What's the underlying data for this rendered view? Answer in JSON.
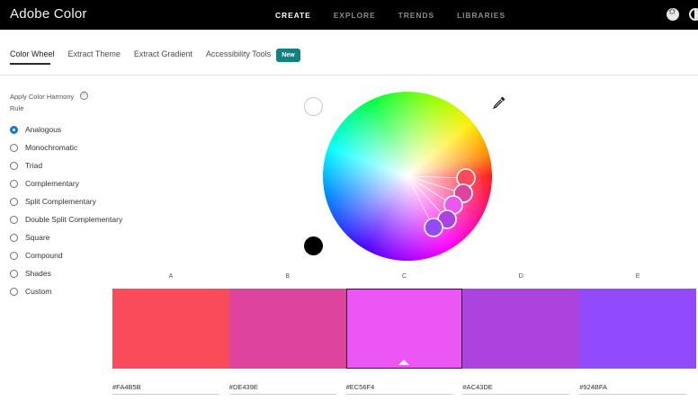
{
  "app": {
    "title": "Adobe Color"
  },
  "topnav": [
    {
      "label": "CREATE",
      "active": true
    },
    {
      "label": "EXPLORE",
      "active": false
    },
    {
      "label": "TRENDS",
      "active": false
    },
    {
      "label": "LIBRARIES",
      "active": false
    }
  ],
  "tabs": [
    {
      "label": "Color Wheel",
      "active": true
    },
    {
      "label": "Extract Theme"
    },
    {
      "label": "Extract Gradient"
    },
    {
      "label": "Accessibility Tools"
    }
  ],
  "badge": "New",
  "harmony": {
    "title": "Apply Color Harmony Rule",
    "info_icon": "ⓘ",
    "selected": "Analogous",
    "rules": [
      "Analogous",
      "Monochromatic",
      "Triad",
      "Complementary",
      "Split Complementary",
      "Double Split Complementary",
      "Square",
      "Compound",
      "Shades",
      "Custom"
    ]
  },
  "palette": {
    "columns": [
      "A",
      "B",
      "C",
      "D",
      "E"
    ],
    "hex_values": [
      "#FA4B5B",
      "#DE439E",
      "#EC56F4",
      "#AC43DE",
      "#924BFA"
    ],
    "selected_index": 2
  },
  "icons": {
    "top_right": [
      "star-icon",
      "theme-toggle-icon"
    ],
    "picker": "eyedropper-icon"
  }
}
